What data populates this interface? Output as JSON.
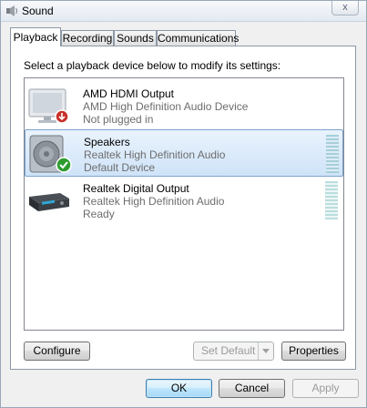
{
  "window": {
    "title": "Sound",
    "close_label": "x"
  },
  "tabs": [
    {
      "label": "Playback",
      "active": true
    },
    {
      "label": "Recording",
      "active": false
    },
    {
      "label": "Sounds",
      "active": false
    },
    {
      "label": "Communications",
      "active": false
    }
  ],
  "playback": {
    "instruction": "Select a playback device below to modify its settings:",
    "devices": [
      {
        "name": "AMD HDMI Output",
        "driver": "AMD High Definition Audio Device",
        "status": "Not plugged in",
        "icon": "monitor-icon",
        "badge": "unplugged-down-arrow-icon",
        "selected": false
      },
      {
        "name": "Speakers",
        "driver": "Realtek High Definition Audio",
        "status": "Default Device",
        "icon": "speaker-icon",
        "badge": "default-checkmark-icon",
        "selected": true
      },
      {
        "name": "Realtek Digital Output",
        "driver": "Realtek High Definition Audio",
        "status": "Ready",
        "icon": "digital-output-icon",
        "badge": "",
        "selected": false
      }
    ],
    "buttons": {
      "configure": "Configure",
      "set_default": "Set Default",
      "properties": "Properties"
    }
  },
  "footer": {
    "ok": "OK",
    "cancel": "Cancel",
    "apply": "Apply"
  },
  "colors": {
    "selected_row": "#cfe3f8",
    "selected_border": "#7da2ce",
    "secondary_text": "#6d6d6d",
    "check_green": "#2e9b2e",
    "unplug_red": "#c8302a"
  }
}
